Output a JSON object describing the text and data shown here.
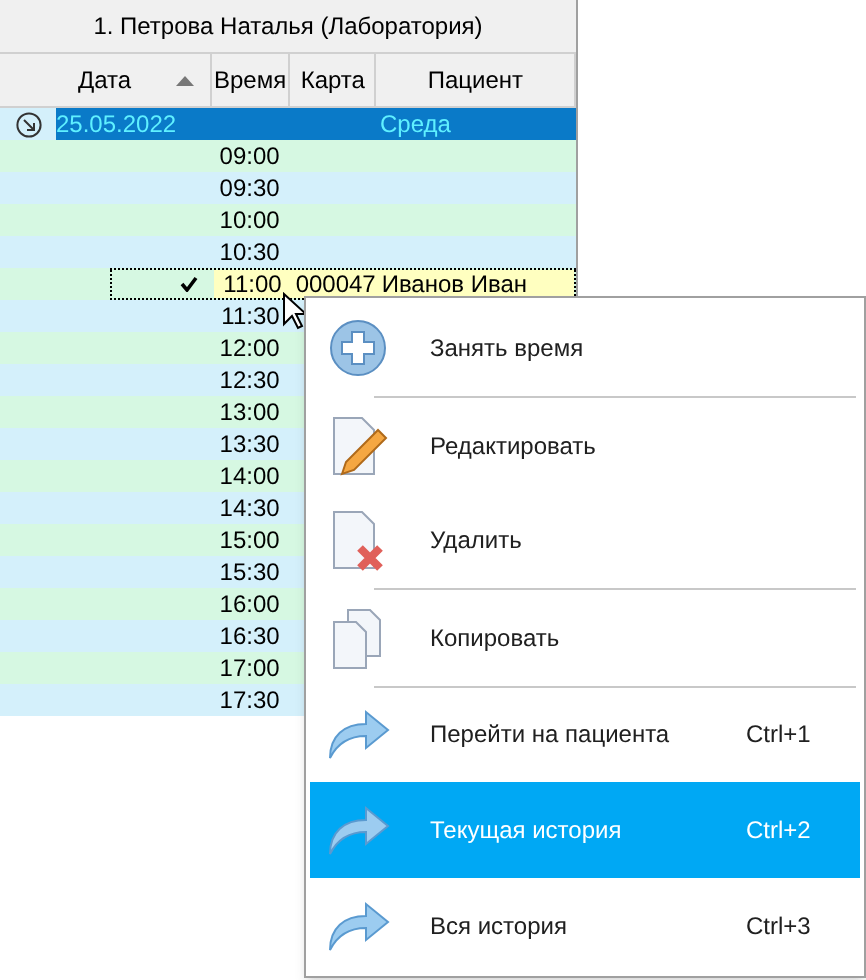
{
  "grid": {
    "title": "1. Петрова Наталья (Лаборатория)",
    "columns": [
      {
        "label": "Дата",
        "sorted": true
      },
      {
        "label": "Время",
        "sorted": false
      },
      {
        "label": "Карта",
        "sorted": false
      },
      {
        "label": "Пациент",
        "sorted": false
      }
    ],
    "group": {
      "date": "25.05.2022",
      "weekday": "Среда",
      "expanded": true
    },
    "rows": [
      {
        "time": "09:00",
        "selected": false
      },
      {
        "time": "09:30",
        "selected": false
      },
      {
        "time": "10:00",
        "selected": false
      },
      {
        "time": "10:30",
        "selected": false
      },
      {
        "time": "11:00",
        "card": "000047",
        "patient": "Иванов Иван",
        "selected": true
      },
      {
        "time": "11:30",
        "selected": false
      },
      {
        "time": "12:00",
        "selected": false
      },
      {
        "time": "12:30",
        "selected": false
      },
      {
        "time": "13:00",
        "selected": false
      },
      {
        "time": "13:30",
        "selected": false
      },
      {
        "time": "14:00",
        "selected": false
      },
      {
        "time": "14:30",
        "selected": false
      },
      {
        "time": "15:00",
        "selected": false
      },
      {
        "time": "15:30",
        "selected": false
      },
      {
        "time": "16:00",
        "selected": false
      },
      {
        "time": "16:30",
        "selected": false
      },
      {
        "time": "17:00",
        "selected": false
      },
      {
        "time": "17:30",
        "selected": false
      }
    ]
  },
  "context_menu": {
    "items": [
      {
        "kind": "add",
        "label": "Занять время",
        "divider_above": false,
        "selected": false
      },
      {
        "kind": "edit",
        "label": "Редактировать",
        "divider_above": true,
        "selected": false
      },
      {
        "kind": "delete",
        "label": "Удалить",
        "divider_above": false,
        "selected": false
      },
      {
        "kind": "copy",
        "label": "Копировать",
        "divider_above": true,
        "selected": false
      },
      {
        "kind": "go",
        "label": "Перейти на пациента",
        "shortcut": "Ctrl+1",
        "divider_above": true,
        "selected": false
      },
      {
        "kind": "go",
        "label": "Текущая история",
        "shortcut": "Ctrl+2",
        "divider_above": false,
        "selected": true
      },
      {
        "kind": "go",
        "label": "Вся история",
        "shortcut": "Ctrl+3",
        "divider_above": false,
        "selected": false
      }
    ]
  }
}
